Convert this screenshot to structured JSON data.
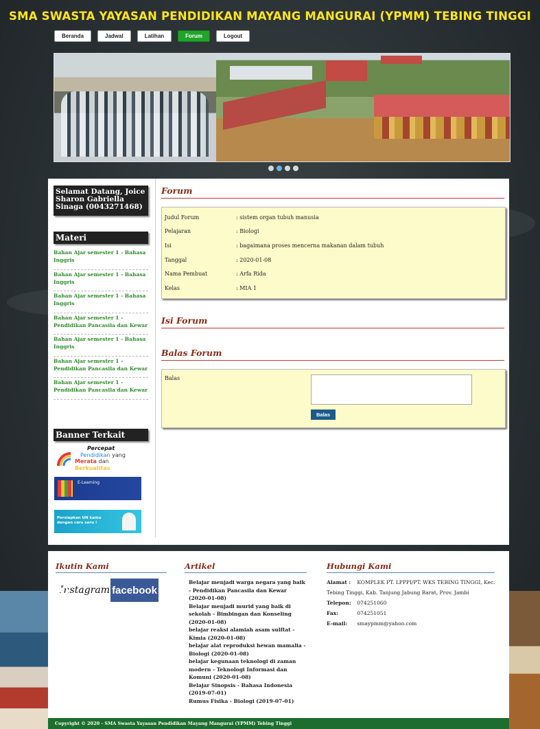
{
  "header": {
    "title": "SMA SWASTA YAYASAN PENDIDIKAN MAYANG MANGURAI (YPMM) TEBING TINGGI"
  },
  "nav": [
    {
      "label": "Beranda",
      "active": false
    },
    {
      "label": "Jadwal",
      "active": false
    },
    {
      "label": "Latihan",
      "active": false
    },
    {
      "label": "Forum",
      "active": true
    },
    {
      "label": "Logout",
      "active": false
    }
  ],
  "sidebar": {
    "welcome": "Selamat Datang, Joice Sharon Gabriella Sinaga (0043271468)",
    "materi_title": "Materi",
    "materi": [
      "Bahan Ajar semester 1 - Bahasa Inggris",
      "Bahan Ajar semester 1 - Bahasa Inggris",
      "Bahan Ajar semester 1 - Bahasa Inggris",
      "Bahan Ajar semester 1 - Pendidikan Pancasila dan Kewar",
      "Bahan Ajar semester 1 - Bahasa Inggris",
      "Bahan Ajar semester 1 - Pendidikan Pancasila dan Kewar",
      "Bahan Ajar semester 1 - Pendidikan Pancasila dan Kewar"
    ],
    "banner_title": "Banner Terkait",
    "banner1": {
      "line1": "Percepat",
      "line2": "Pendidikan",
      "line2b": "yang",
      "line3a": "Merata",
      "line3b": "dan",
      "line3c": "Berkualitas"
    },
    "banner2": {
      "label": "E-Learning"
    },
    "banner3": {
      "label": "Persiapkan UN kamu dengan cara seru !"
    }
  },
  "forum": {
    "title": "Forum",
    "rows": [
      {
        "label": "Judul Forum",
        "value": ": sistem organ tubuh manusia"
      },
      {
        "label": "Pelajaran",
        "value": ": Biologi"
      },
      {
        "label": "Isi",
        "value": ": bagaimana proses mencerna makanan dalam tubuh"
      },
      {
        "label": "Tanggal",
        "value": ": 2020-01-08"
      },
      {
        "label": "Nama Pembuat",
        "value": ": Arfa Rida"
      },
      {
        "label": "Kelas",
        "value": ": MIA 1"
      }
    ],
    "isi_title": "Isi Forum",
    "balas_title": "Balas Forum",
    "balas_label": "Balas",
    "balas_value": "",
    "balas_button": "Balas"
  },
  "footer": {
    "follow_title": "Ikutin Kami",
    "instagram": "Instagram",
    "facebook": "facebook",
    "artikel_title": "Artikel",
    "artikel": [
      "Belajar menjadi warga negara yang baik - Pendidikan Pancasila dan Kewar (2020-01-08)",
      "Belajar menjadi murid yang baik di sekolah - Bimbingan dan Konseling (2020-01-08)",
      "belajar reaksi alamiah asam sulftat - Kimia (2020-01-08)",
      "belajar alat reproduksi hewan mamalia - Biologi (2020-01-08)",
      "belajar kegunaan teknologi di zaman modern - Teknologi Informasi dan Komuni (2020-01-08)",
      "Belajar Sinopsis - Bahasa Indonesia (2019-07-01)",
      "Rumus Fisika - Biologi (2019-07-01)"
    ],
    "contact_title": "Hubungi Kami",
    "alamat_label": "Alamat :",
    "alamat": "KOMPLEK PT. LPPPI/PT. WKS TEBING TINGGI, Kec. Tebing Tinggi, Kab. Tanjung Jabung Barat, Prov. Jambi",
    "telepon_label": "Telepon:",
    "telepon": "074251060",
    "fax_label": "Fax:",
    "fax": "074251051",
    "email_label": "E-mail:",
    "email": "smaypmm@yahoo.com",
    "copyright": "Copyright © 2020 - SMA Swasta Yayasan Pendidikan Mayang Mangurai (YPMM) Tebing Tinggi"
  },
  "colors": {
    "title": "#ffe51b",
    "nav_active": "#22a32a",
    "section_title": "#8b2a14",
    "link": "#2f8a2a",
    "footer_bar": "#1d6e2e",
    "info_bg": "#fdfbc9"
  }
}
